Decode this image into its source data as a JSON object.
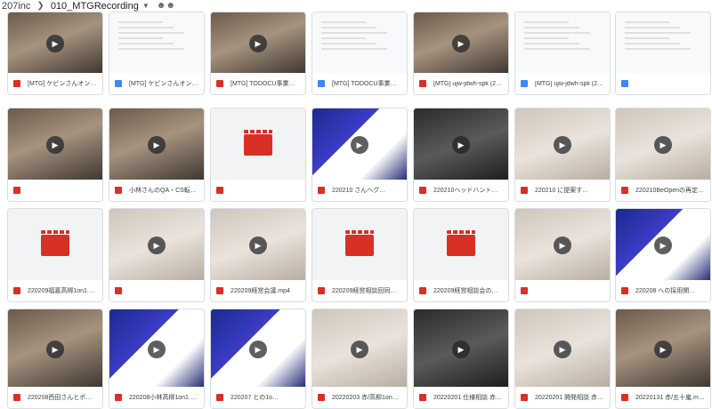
{
  "breadcrumb": {
    "root": "207inc",
    "folder": "010_MTGRecording",
    "separator_icon": "chevron-right-icon",
    "caret_icon": "caret-down-icon",
    "shared_icon": "people-icon"
  },
  "colors": {
    "video_icon": "#d93025",
    "doc_icon": "#4285f4",
    "tile_border": "#dadce0",
    "play_button": "#202124"
  },
  "rows": [
    [
      {
        "name": "[MTG] ケビンさんオンボ…",
        "type": "video",
        "thumb": "video"
      },
      {
        "name": "[MTG] ケビンさんオンボ…",
        "type": "doc",
        "thumb": "doc"
      },
      {
        "name": "[MTG] TODOCU事業部定…",
        "type": "video",
        "thumb": "video"
      },
      {
        "name": "[MTG] TODOCU事業部定…",
        "type": "doc",
        "thumb": "doc"
      },
      {
        "name": "[MTG] ujw-jdwh-spk (20…",
        "type": "video",
        "thumb": "video"
      },
      {
        "name": "[MTG] ujw-jdwh-spk (20…",
        "type": "doc",
        "thumb": "doc"
      },
      {
        "name": "",
        "type": "doc",
        "thumb": "doc"
      }
    ],
    [
      {
        "name": "",
        "type": "video",
        "thumb": "video"
      },
      {
        "name": "小林さんのQA・CS転身…",
        "type": "video",
        "thumb": "video"
      },
      {
        "name": "",
        "type": "video",
        "thumb": "placeholder"
      },
      {
        "name": "220210 さんヘグ…",
        "type": "video",
        "thumb": "poster"
      },
      {
        "name": "220210ヘッドハントリ…",
        "type": "video",
        "thumb": "dark"
      },
      {
        "name": "220210 に提案す…",
        "type": "video",
        "thumb": "light"
      },
      {
        "name": "220210BeOpenの再定義…",
        "type": "video",
        "thumb": "light"
      }
    ],
    [
      {
        "name": "220209福嘉高柳1on1.m…",
        "type": "video",
        "thumb": "placeholder"
      },
      {
        "name": "",
        "type": "video",
        "thumb": "light"
      },
      {
        "name": "220209経営会議.mp4",
        "type": "video",
        "thumb": "light"
      },
      {
        "name": "220209経営相談回同さ…",
        "type": "video",
        "thumb": "placeholder"
      },
      {
        "name": "220209経営相談会の準…",
        "type": "video",
        "thumb": "placeholder"
      },
      {
        "name": "",
        "type": "video",
        "thumb": "light"
      },
      {
        "name": "220208 への採用関…",
        "type": "video",
        "thumb": "poster"
      }
    ],
    [
      {
        "name": "220208西田さんとボジ…",
        "type": "video",
        "thumb": "video"
      },
      {
        "name": "220208小林高柳1on1.m…",
        "type": "video",
        "thumb": "poster"
      },
      {
        "name": "220207 との1o…",
        "type": "video",
        "thumb": "poster"
      },
      {
        "name": "20220203 赤/高柳1on1…",
        "type": "video",
        "thumb": "light"
      },
      {
        "name": "20220201 仕様相談 赤/…",
        "type": "video",
        "thumb": "dark"
      },
      {
        "name": "20220201 開発相談 赤/…",
        "type": "video",
        "thumb": "light"
      },
      {
        "name": "20220131 赤/五十嵐.mp4",
        "type": "video",
        "thumb": "video"
      }
    ]
  ]
}
